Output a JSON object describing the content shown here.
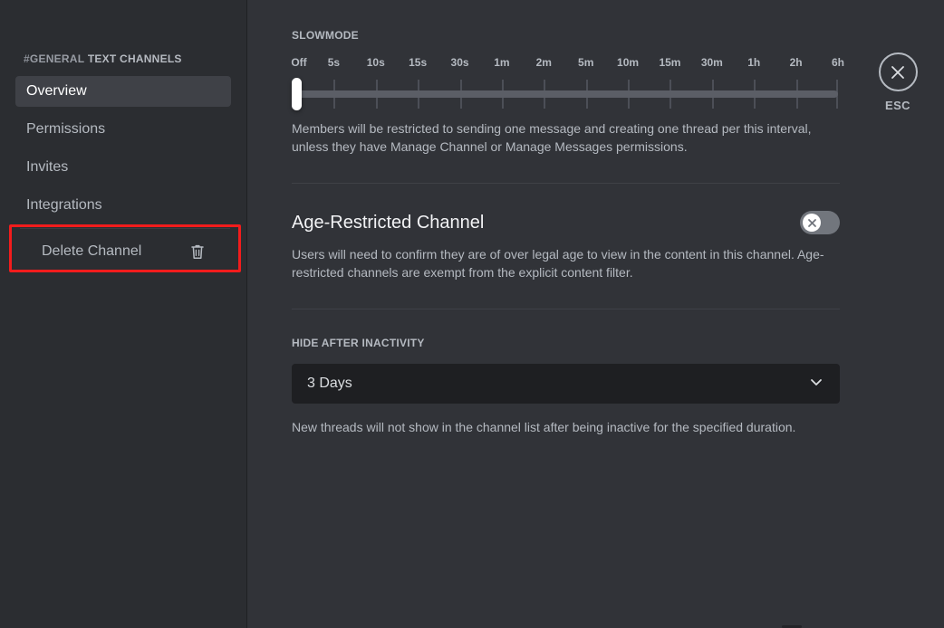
{
  "sidebar": {
    "header": {
      "hash": "#",
      "channel": "GENERAL",
      "suffix": "TEXT CHANNELS"
    },
    "items": [
      {
        "label": "Overview",
        "selected": true
      },
      {
        "label": "Permissions",
        "selected": false
      },
      {
        "label": "Invites",
        "selected": false
      },
      {
        "label": "Integrations",
        "selected": false
      }
    ],
    "delete": {
      "label": "Delete Channel",
      "icon": "trash-icon",
      "highlight_color": "#f21c1c"
    }
  },
  "close": {
    "label": "ESC",
    "icon": "close-icon"
  },
  "slowmode": {
    "label": "SLOWMODE",
    "ticks": [
      "Off",
      "5s",
      "10s",
      "15s",
      "30s",
      "1m",
      "2m",
      "5m",
      "10m",
      "15m",
      "30m",
      "1h",
      "2h",
      "6h"
    ],
    "value": "Off",
    "value_index": 0,
    "description": "Members will be restricted to sending one message and creating one thread per this interval, unless they have Manage Channel or Manage Messages permissions."
  },
  "age_restricted": {
    "title": "Age-Restricted Channel",
    "toggle_state": "off",
    "toggle_icon": "close-icon",
    "description": "Users will need to confirm they are of over legal age to view in the content in this channel. Age-restricted channels are exempt from the explicit content filter."
  },
  "hide_after_inactivity": {
    "label": "HIDE AFTER INACTIVITY",
    "value": "3 Days",
    "chevron_icon": "chevron-down-icon",
    "description": "New threads will not show in the channel list after being inactive for the specified duration."
  },
  "colors": {
    "sidebar_bg": "#2b2d31",
    "content_bg": "#313338",
    "selected_bg": "#3f4147",
    "text_muted": "#b5bac1",
    "text_bright": "#f2f3f5",
    "highlight": "#f21c1c",
    "toggle_off": "#72767d"
  }
}
